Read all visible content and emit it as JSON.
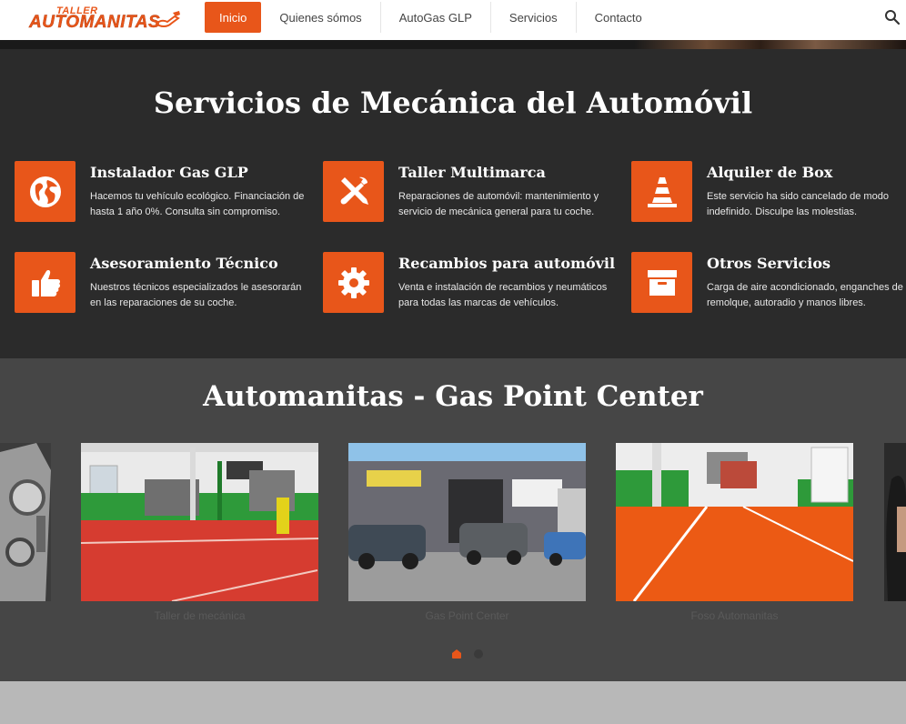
{
  "brand": {
    "small": "TALLER",
    "big": "AUTOMANITAS"
  },
  "nav": {
    "items": [
      {
        "label": "Inicio",
        "active": true
      },
      {
        "label": "Quienes sómos",
        "active": false
      },
      {
        "label": "AutoGas GLP",
        "active": false
      },
      {
        "label": "Servicios",
        "active": false
      },
      {
        "label": "Contacto",
        "active": false
      }
    ],
    "search_icon": "search-icon"
  },
  "services": {
    "title": "Servicios de Mecánica del Automóvil",
    "items": [
      {
        "title": "Instalador Gas GLP",
        "text": "Hacemos tu vehículo ecológico. Financiación de hasta 1 año 0%. Consulta sin compromiso.",
        "icon": "globe-icon"
      },
      {
        "title": "Taller Multimarca",
        "text": "Reparaciones de automóvil: mantenimiento y servicio de mecánica general para tu coche.",
        "icon": "tools-icon"
      },
      {
        "title": "Alquiler de Box",
        "text": "Este servicio ha sido cancelado de modo indefinido. Disculpe las molestias.",
        "icon": "traffic-cone-icon"
      },
      {
        "title": "Asesoramiento Técnico",
        "text": "Nuestros técnicos especializados le asesorarán en las reparaciones de su coche.",
        "icon": "thumbs-up-icon"
      },
      {
        "title": "Recambios para automóvil",
        "text": "Venta e instalación de recambios y neumáticos para todas las marcas de vehículos.",
        "icon": "gear-icon"
      },
      {
        "title": "Otros Servicios",
        "text": "Carga de aire acondicionado, enganches de remolque, autoradio y manos libres.",
        "icon": "archive-box-icon"
      }
    ]
  },
  "gallery": {
    "title": "Automanitas - Gas Point Center",
    "captions": [
      "Taller de mecánica",
      "Gas Point Center",
      "Foso Automanitas"
    ],
    "pages": 2,
    "current_page": 1
  },
  "colors": {
    "accent": "#e8561a",
    "dark": "#2b2b2b",
    "gallery_bg": "#464646"
  }
}
